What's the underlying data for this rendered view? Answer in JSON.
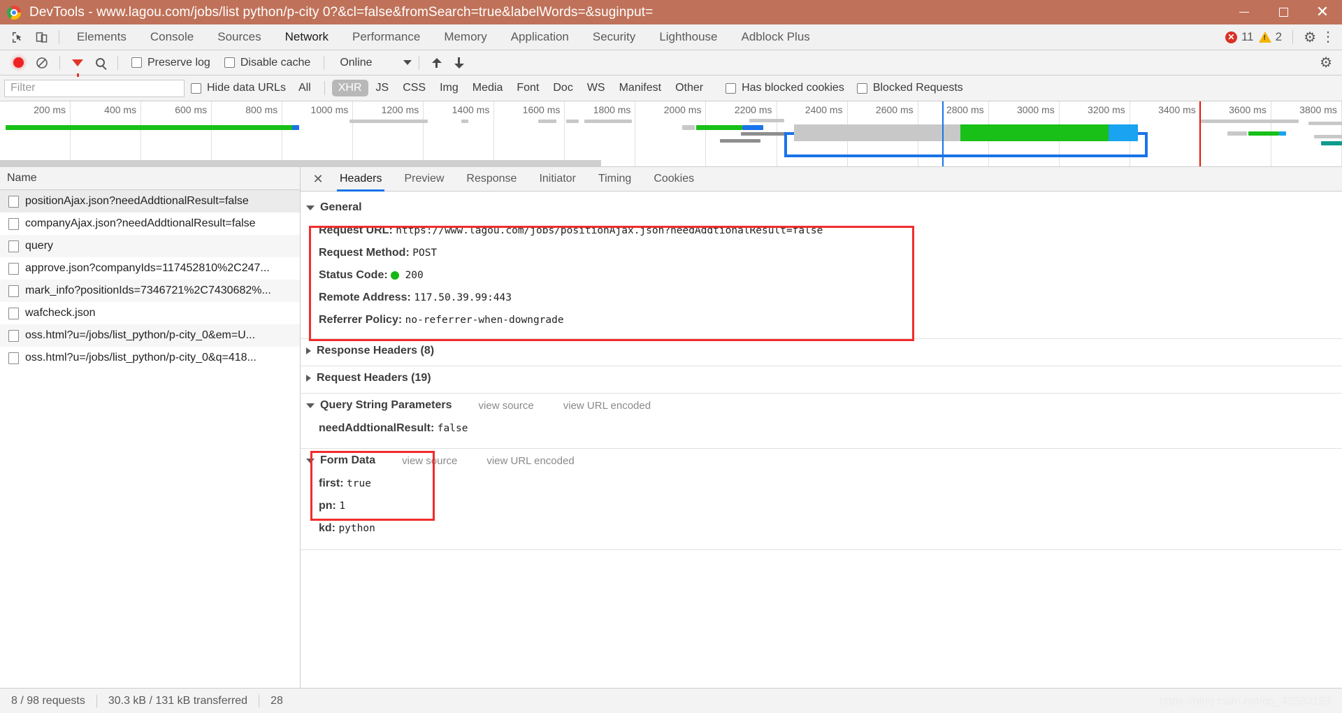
{
  "window": {
    "title": "DevTools - www.lagou.com/jobs/list python/p-city 0?&cl=false&fromSearch=true&labelWords=&suginput=",
    "logo_icon": "chrome-logo-icon",
    "minimize_label": "–",
    "maximize_label": "□",
    "close_label": "✕"
  },
  "tabbar": {
    "inspect_icon": "inspect-element-icon",
    "device_icon": "device-toolbar-icon",
    "tabs": [
      {
        "label": "Elements",
        "active": false
      },
      {
        "label": "Console",
        "active": false
      },
      {
        "label": "Sources",
        "active": false
      },
      {
        "label": "Network",
        "active": true
      },
      {
        "label": "Performance",
        "active": false
      },
      {
        "label": "Memory",
        "active": false
      },
      {
        "label": "Application",
        "active": false
      },
      {
        "label": "Security",
        "active": false
      },
      {
        "label": "Lighthouse",
        "active": false
      },
      {
        "label": "Adblock Plus",
        "active": false
      }
    ],
    "error_count": "11",
    "warning_count": "2",
    "error_icon": "error-circle-icon",
    "warning_icon": "warning-triangle-icon",
    "settings_icon": "gear-icon",
    "more_icon": "kebab-menu-icon",
    "gear_glyph": "⚙",
    "kebab_glyph": "⋮",
    "error_glyph": "✕"
  },
  "network_toolbar": {
    "record_icon": "record-button-icon",
    "clear_icon": "clear-requests-icon",
    "filter_icon": "filter-funnel-icon",
    "search_icon": "search-icon",
    "preserve_log_label": "Preserve log",
    "preserve_log_checked": false,
    "disable_cache_label": "Disable cache",
    "disable_cache_checked": false,
    "throttling_value": "Online",
    "import_icon": "import-har-icon",
    "export_icon": "export-har-icon",
    "settings_icon": "network-settings-gear-icon",
    "clear_glyph": "⊘"
  },
  "filter_row": {
    "filter_placeholder": "Filter",
    "filter_value": "",
    "hide_data_urls_label": "Hide data URLs",
    "hide_data_urls_checked": false,
    "types": [
      {
        "label": "All",
        "active": false
      },
      {
        "label": "XHR",
        "active": true
      },
      {
        "label": "JS",
        "active": false
      },
      {
        "label": "CSS",
        "active": false
      },
      {
        "label": "Img",
        "active": false
      },
      {
        "label": "Media",
        "active": false
      },
      {
        "label": "Font",
        "active": false
      },
      {
        "label": "Doc",
        "active": false
      },
      {
        "label": "WS",
        "active": false
      },
      {
        "label": "Manifest",
        "active": false
      },
      {
        "label": "Other",
        "active": false
      }
    ],
    "has_blocked_cookies_label": "Has blocked cookies",
    "has_blocked_cookies_checked": false,
    "blocked_requests_label": "Blocked Requests",
    "blocked_requests_checked": false
  },
  "overview": {
    "ticks": [
      "200 ms",
      "400 ms",
      "600 ms",
      "800 ms",
      "1000 ms",
      "1200 ms",
      "1400 ms",
      "1600 ms",
      "1800 ms",
      "2000 ms",
      "2200 ms",
      "2400 ms",
      "2600 ms",
      "2800 ms",
      "3000 ms",
      "3200 ms",
      "3400 ms",
      "3600 ms",
      "3800 ms"
    ],
    "tick_interval_ms": 200,
    "total_ms": 3900
  },
  "request_list": {
    "column_header": "Name",
    "rows": [
      {
        "name": "positionAjax.json?needAddtionalResult=false",
        "selected": true
      },
      {
        "name": "companyAjax.json?needAddtionalResult=false",
        "selected": false
      },
      {
        "name": "query",
        "selected": false
      },
      {
        "name": "approve.json?companyIds=117452810%2C247...",
        "selected": false
      },
      {
        "name": "mark_info?positionIds=7346721%2C7430682%...",
        "selected": false
      },
      {
        "name": "wafcheck.json",
        "selected": false
      },
      {
        "name": "oss.html?u=/jobs/list_python/p-city_0&em=U...",
        "selected": false
      },
      {
        "name": "oss.html?u=/jobs/list_python/p-city_0&q=418...",
        "selected": false
      }
    ]
  },
  "detail": {
    "close_glyph": "✕",
    "tabs": [
      {
        "label": "Headers",
        "active": true
      },
      {
        "label": "Preview",
        "active": false
      },
      {
        "label": "Response",
        "active": false
      },
      {
        "label": "Initiator",
        "active": false
      },
      {
        "label": "Timing",
        "active": false
      },
      {
        "label": "Cookies",
        "active": false
      }
    ],
    "general": {
      "title": "General",
      "expanded": true,
      "rows": [
        {
          "key": "Request URL:",
          "value": "https://www.lagou.com/jobs/positionAjax.json?needAddtionalResult=false"
        },
        {
          "key": "Request Method:",
          "value": "POST"
        },
        {
          "key": "Status Code:",
          "value": "200",
          "status_dot": "#15b715"
        },
        {
          "key": "Remote Address:",
          "value": "117.50.39.99:443"
        },
        {
          "key": "Referrer Policy:",
          "value": "no-referrer-when-downgrade"
        }
      ]
    },
    "response_headers": {
      "title": "Response Headers (8)",
      "expanded": false
    },
    "request_headers": {
      "title": "Request Headers (19)",
      "expanded": false
    },
    "query_string": {
      "title": "Query String Parameters",
      "expanded": true,
      "view_source_label": "view source",
      "view_url_encoded_label": "view URL encoded",
      "rows": [
        {
          "key": "needAddtionalResult:",
          "value": "false"
        }
      ]
    },
    "form_data": {
      "title": "Form Data",
      "expanded": true,
      "view_source_label": "view source",
      "view_url_encoded_label": "view URL encoded",
      "rows": [
        {
          "key": "first:",
          "value": "true"
        },
        {
          "key": "pn:",
          "value": "1"
        },
        {
          "key": "kd:",
          "value": "python"
        }
      ]
    }
  },
  "status_bar": {
    "requests": "8 / 98 requests",
    "transferred": "30.3 kB / 131 kB transferred",
    "resources": "28"
  },
  "watermark": "https://blog.csdn.net/qq_43580193",
  "colors": {
    "title_bar": "#bf7259",
    "accent_blue": "#1a73e8",
    "annotation_red": "#f22c2c",
    "status_ok_green": "#15b715",
    "error_red": "#d93025",
    "warning_yellow": "#f5b400"
  }
}
